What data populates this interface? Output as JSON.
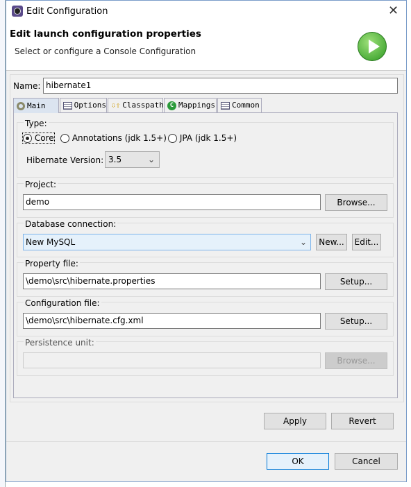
{
  "window": {
    "title": "Edit Configuration",
    "close_icon": "close-icon"
  },
  "header": {
    "title": "Edit launch configuration properties",
    "subtitle": "Select or configure a Console Configuration"
  },
  "name": {
    "label": "Name:",
    "value": "hibernate1"
  },
  "tabs": [
    {
      "label": "Main",
      "icon": "hibernate-icon",
      "active": true
    },
    {
      "label": "Options",
      "icon": "table-icon"
    },
    {
      "label": "Classpath",
      "icon": "classpath-icon"
    },
    {
      "label": "Mappings",
      "icon": "mappings-c-icon"
    },
    {
      "label": "Common",
      "icon": "table-icon"
    }
  ],
  "type": {
    "label": "Type:",
    "options": [
      "Core",
      "Annotations (jdk 1.5+)",
      "JPA (jdk 1.5+)"
    ],
    "selected": "Core"
  },
  "hibernate_version": {
    "label": "Hibernate Version:",
    "value": "3.5"
  },
  "project": {
    "label": "Project:",
    "value": "demo",
    "browse": "Browse..."
  },
  "db": {
    "label": "Database connection:",
    "value": "New MySQL",
    "new": "New...",
    "edit": "Edit..."
  },
  "property_file": {
    "label": "Property file:",
    "value": "\\demo\\src\\hibernate.properties",
    "setup": "Setup..."
  },
  "config_file": {
    "label": "Configuration file:",
    "value": "\\demo\\src\\hibernate.cfg.xml",
    "setup": "Setup..."
  },
  "persistence": {
    "label": "Persistence unit:",
    "value": "",
    "browse": "Browse..."
  },
  "buttons": {
    "apply": "Apply",
    "revert": "Revert",
    "ok": "OK",
    "cancel": "Cancel"
  }
}
